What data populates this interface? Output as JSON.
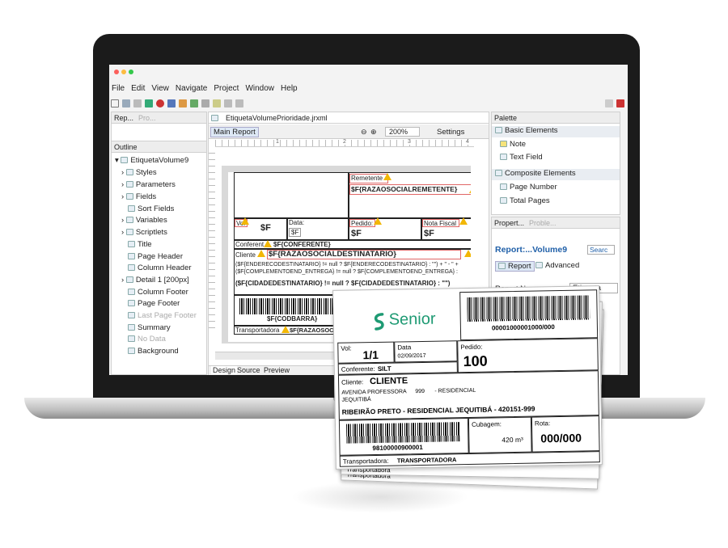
{
  "menu": [
    "File",
    "Edit",
    "View",
    "Navigate",
    "Project",
    "Window",
    "Help"
  ],
  "left_top_tabs": {
    "rep": "Rep...",
    "pro": "Pro..."
  },
  "outline": {
    "tab": "Outline",
    "root": "EtiquetaVolume9",
    "items": [
      {
        "label": "Styles",
        "dim": false
      },
      {
        "label": "Parameters",
        "dim": false
      },
      {
        "label": "Fields",
        "dim": false
      },
      {
        "label": "Sort Fields",
        "dim": false
      },
      {
        "label": "Variables",
        "dim": false
      },
      {
        "label": "Scriptlets",
        "dim": false
      },
      {
        "label": "Title",
        "dim": false
      },
      {
        "label": "Page Header",
        "dim": false
      },
      {
        "label": "Column Header",
        "dim": false
      },
      {
        "label": "Detail 1 [200px]",
        "dim": false
      },
      {
        "label": "Column Footer",
        "dim": false
      },
      {
        "label": "Page Footer",
        "dim": false
      },
      {
        "label": "Last Page Footer",
        "dim": true
      },
      {
        "label": "Summary",
        "dim": false
      },
      {
        "label": "No Data",
        "dim": true
      },
      {
        "label": "Background",
        "dim": false
      }
    ]
  },
  "editor": {
    "file_tab": "EtiquetaVolumePrioridade.jrxml",
    "main_report": "Main Report",
    "zoom": "200%",
    "settings": "Settings",
    "bottom_tabs": [
      "Design",
      "Source",
      "Preview"
    ],
    "ruler": [
      "1",
      "2",
      "3",
      "4"
    ]
  },
  "design": {
    "remetente": "Remetente",
    "razao_remetente": "$F{RAZAOSOCIALREMETENTE}",
    "vol": "Vol",
    "vol_field": "$F",
    "data": "Data:",
    "data_field": "$F",
    "pedido": "Pedido:",
    "pedido_field": "$F",
    "nota": "Nota Fiscal",
    "nota_field": "$F",
    "conferente": "Conferent",
    "conferente_field": "$F{CONFERENTE}",
    "cliente": "Cliente",
    "cliente_field": "$F{RAZAOSOCIALDESTINATARIO}",
    "endereco1": "($F{ENDERECODESTINATARIO} != null ? $F{ENDERECODESTINATARIO} : \"\") + \" - \" +",
    "endereco2": "($F{COMPLEMENTOEND_ENTREGA} != null ? $F{COMPLEMENTOEND_ENTREGA} :",
    "cidade": "($F{CIDADEDESTINATARIO} != null ? $F{CIDADEDESTINATARIO} : \"\")",
    "codbarra": "$F{CODBARRA}",
    "transportadora": "Transportadora",
    "transp_field": "$F{RAZAOSOCIAL"
  },
  "palette": {
    "tab": "Palette",
    "groups": [
      {
        "label": "Basic Elements",
        "items": [
          "Note",
          "Text Field"
        ]
      },
      {
        "label": "Composite Elements",
        "items": [
          "Page Number",
          "Total Pages"
        ]
      }
    ]
  },
  "properties": {
    "tab": "Propert...",
    "tab2": "Proble...",
    "title": "Report:...Volume9",
    "search": "Searc",
    "report_tab": "Report",
    "advanced_tab": "Advanced",
    "row_label": "Report Name",
    "row_value": "Etiqueta"
  },
  "label": {
    "brand": "Senior",
    "barcode_top": "00001000001000/000",
    "vol_label": "Vol:",
    "vol": "1/1",
    "data_label": "Data",
    "data": "02/09/2017",
    "pedido_label": "Pedido:",
    "pedido": "100",
    "conferente_label": "Conferente:",
    "conferente": "SILT",
    "cliente_label": "Cliente:",
    "cliente": "CLIENTE",
    "endereco": "AVENIDA PROFESSORA",
    "numero": "999",
    "complemento": "- RESIDENCIAL",
    "bairro": "JEQUITIBÁ",
    "cidade": "RIBEIRÃO PRETO - RESIDENCIAL JEQUITIBÁ - 420151-999",
    "barcode_bottom": "98100000900001",
    "cubagem_label": "Cubagem:",
    "cubagem": "420 m³",
    "rota_label": "Rota:",
    "rota": "000/000",
    "transp_label": "Transportadora:",
    "transp": "TRANSPORTADORA",
    "back1": "Transportadora",
    "back2": "Transportadora"
  },
  "colors": {
    "accent": "#1f5fa8",
    "senior_green": "#1e9a73",
    "warning": "#f2b705",
    "field_border": "#e06666"
  }
}
